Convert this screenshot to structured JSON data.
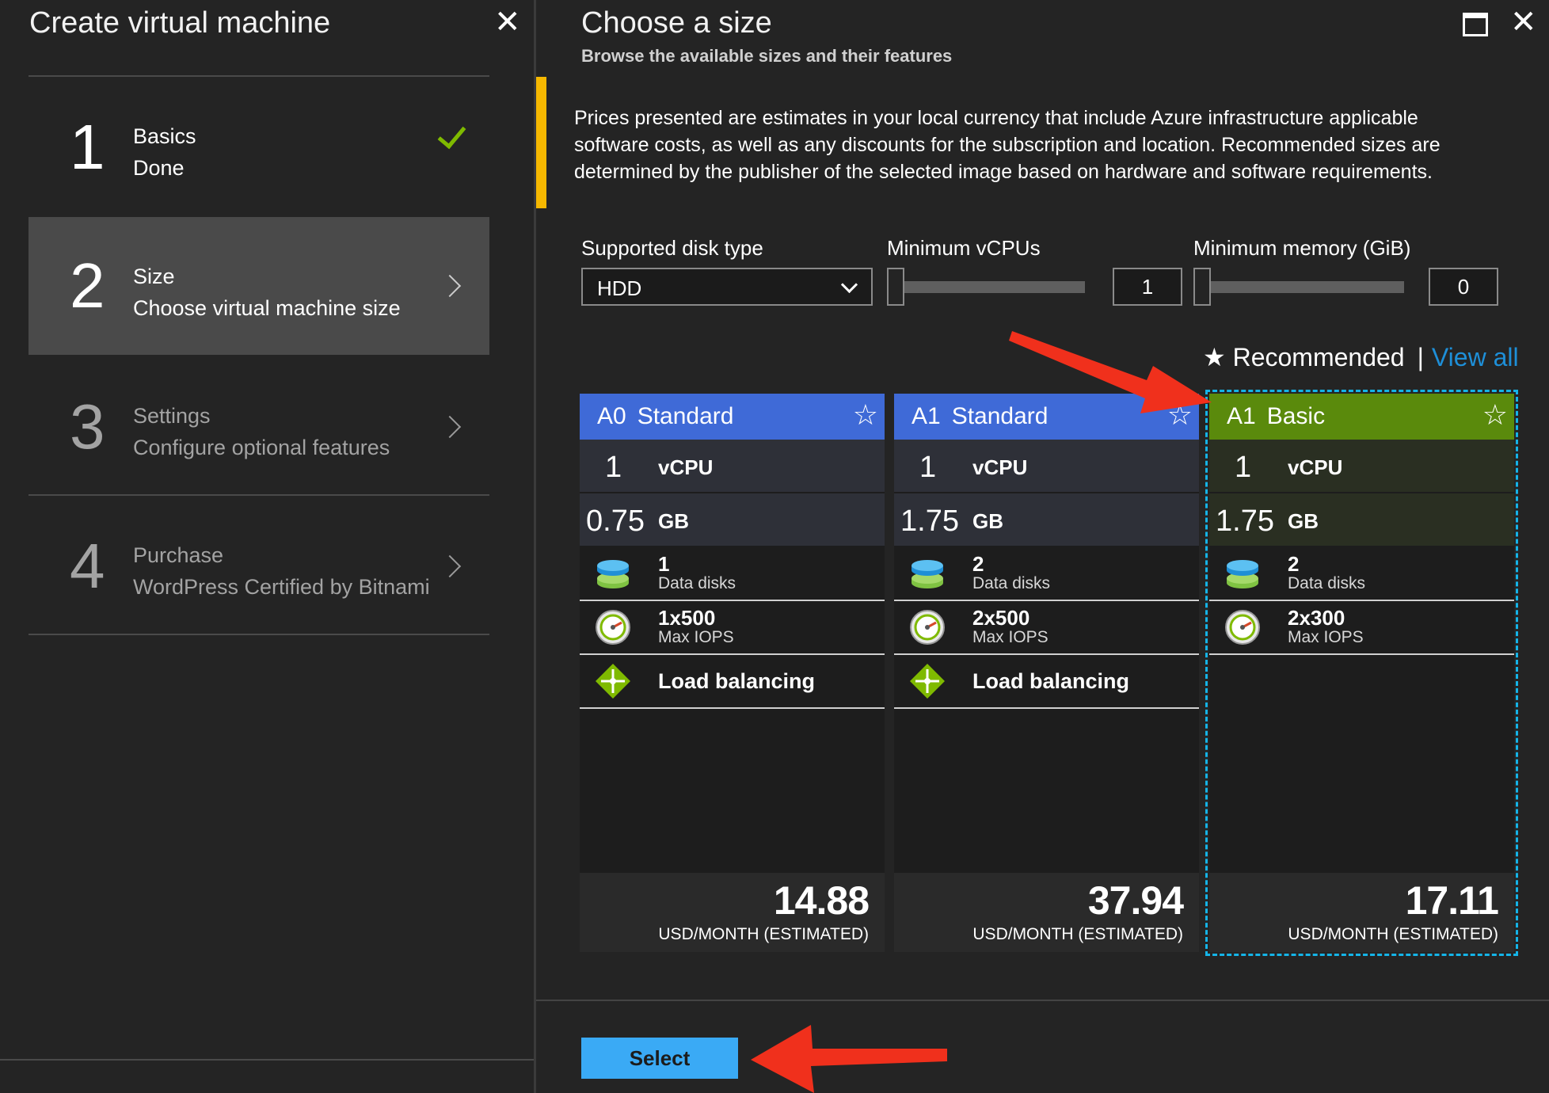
{
  "left_blade": {
    "title": "Create virtual machine",
    "steps": [
      {
        "num": "1",
        "title": "Basics",
        "subtitle": "Done"
      },
      {
        "num": "2",
        "title": "Size",
        "subtitle": "Choose virtual machine size"
      },
      {
        "num": "3",
        "title": "Settings",
        "subtitle": "Configure optional features"
      },
      {
        "num": "4",
        "title": "Purchase",
        "subtitle": "WordPress Certified by Bitnami"
      }
    ]
  },
  "right_blade": {
    "title": "Choose a size",
    "subtitle": "Browse the available sizes and their features",
    "notice": "Prices presented are estimates in your local currency that include Azure infrastructure applicable software costs, as well as any discounts for the subscription and location. Recommended sizes are determined by the publisher of the selected image based on hardware and software requirements.",
    "filters": {
      "disk_type_label": "Supported disk type",
      "disk_type_value": "HDD",
      "vcpu_label": "Minimum vCPUs",
      "vcpu_value": "1",
      "memory_label": "Minimum memory (GiB)",
      "memory_value": "0"
    },
    "recommended_label": "Recommended",
    "recommended_separator": "|",
    "view_all_label": "View all",
    "cards": [
      {
        "tier": "A0",
        "kind": "Standard",
        "vcpu": "1",
        "vcpu_unit": "vCPU",
        "memory": "0.75",
        "memory_unit": "GB",
        "disks": "1",
        "disks_label": "Data disks",
        "iops": "1x500",
        "iops_label": "Max IOPS",
        "lb_label": "Load balancing",
        "price": "14.88",
        "price_unit": "USD/MONTH (ESTIMATED)"
      },
      {
        "tier": "A1",
        "kind": "Standard",
        "vcpu": "1",
        "vcpu_unit": "vCPU",
        "memory": "1.75",
        "memory_unit": "GB",
        "disks": "2",
        "disks_label": "Data disks",
        "iops": "2x500",
        "iops_label": "Max IOPS",
        "lb_label": "Load balancing",
        "price": "37.94",
        "price_unit": "USD/MONTH (ESTIMATED)"
      },
      {
        "tier": "A1",
        "kind": "Basic",
        "vcpu": "1",
        "vcpu_unit": "vCPU",
        "memory": "1.75",
        "memory_unit": "GB",
        "disks": "2",
        "disks_label": "Data disks",
        "iops": "2x300",
        "iops_label": "Max IOPS",
        "price": "17.11",
        "price_unit": "USD/MONTH (ESTIMATED)"
      }
    ],
    "select_label": "Select"
  },
  "colors": {
    "accent_yellow": "#f6b800",
    "standard_header": "#3f6ad7",
    "basic_header": "#5a8a0c",
    "select_button": "#3aaaf5",
    "selection_outline": "#14b4e8",
    "annotation_arrow": "#f0301c",
    "check_green": "#7fba00"
  },
  "icons": [
    "close-icon",
    "maximize-icon",
    "check-icon",
    "chevron-right-icon",
    "chevron-down-icon",
    "star-icon",
    "data-disks-icon",
    "gauge-icon",
    "load-balancing-icon"
  ]
}
